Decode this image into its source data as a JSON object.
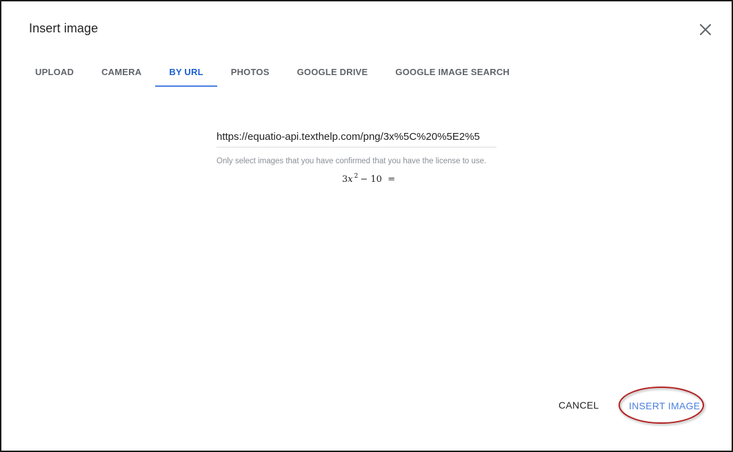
{
  "dialog": {
    "title": "Insert image"
  },
  "tabs": [
    {
      "label": "UPLOAD",
      "active": false
    },
    {
      "label": "CAMERA",
      "active": false
    },
    {
      "label": "BY URL",
      "active": true
    },
    {
      "label": "PHOTOS",
      "active": false
    },
    {
      "label": "GOOGLE DRIVE",
      "active": false
    },
    {
      "label": "GOOGLE IMAGE SEARCH",
      "active": false
    }
  ],
  "url_input": {
    "value": "https://equatio-api.texthelp.com/png/3x%5C%20%5E2%5"
  },
  "license_note": "Only select images that you have confirmed that you have the license to use.",
  "preview": {
    "coef": "3",
    "var": "x",
    "exponent": "2",
    "rest": "− 10  ="
  },
  "actions": {
    "cancel_label": "CANCEL",
    "insert_label": "INSERT IMAGE"
  },
  "colors": {
    "accent": "#4a7fe0",
    "active_tab": "#1a5fd1",
    "highlight": "#b22222"
  },
  "icons": {
    "close": "close-icon"
  }
}
